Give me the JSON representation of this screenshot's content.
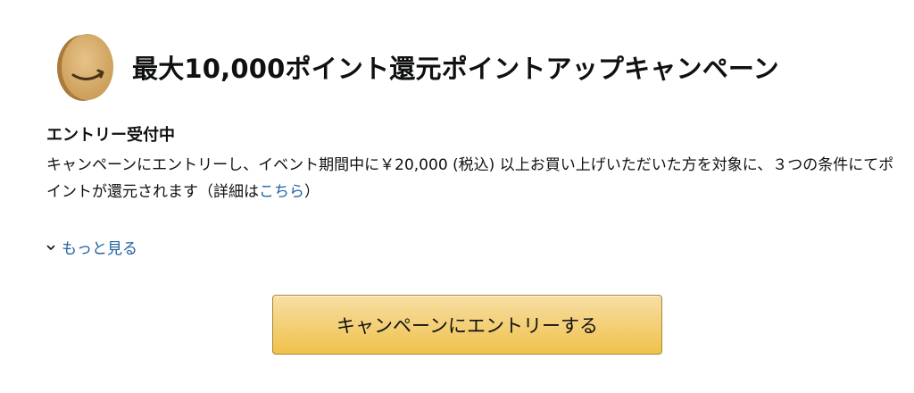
{
  "header": {
    "logo_icon": "amazon-points-coin-icon",
    "title": "最大10,000ポイント還元ポイントアップキャンペーン"
  },
  "status": {
    "text": "エントリー受付中"
  },
  "description": {
    "text_before_link": "キャンペーンにエントリーし、イベント期間中に￥20,000 (税込) 以上お買い上げいただいた方を対象に、３つの条件にてポイントが還元されます（詳細は",
    "link_text": "こちら",
    "text_after_link": "）"
  },
  "more": {
    "icon": "chevron-down-icon",
    "label": "もっと見る"
  },
  "entry_button": {
    "label": "キャンペーンにエントリーする"
  },
  "colors": {
    "link": "#2162a1",
    "button_top": "#f7dfa5",
    "button_bottom": "#f0c14b",
    "button_border": "#a88734",
    "coin": "#d7ad6b"
  }
}
